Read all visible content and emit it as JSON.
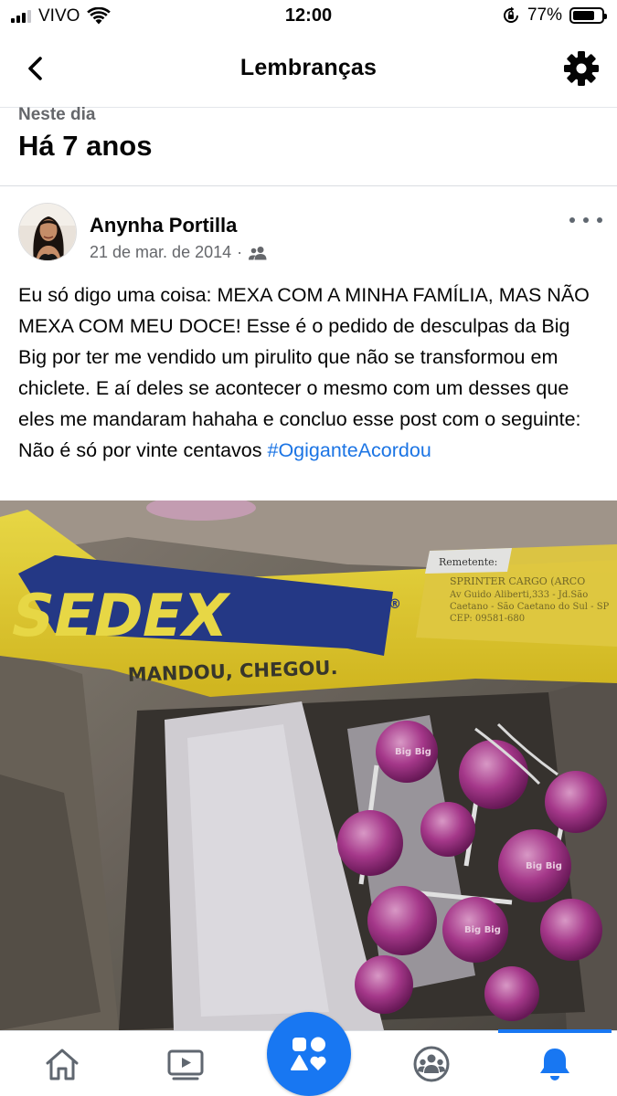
{
  "status_bar": {
    "carrier": "VIVO",
    "time": "12:00",
    "battery": "77%",
    "battery_level": 0.77,
    "icons": [
      "signal-icon",
      "wifi-icon",
      "orientation-lock-icon",
      "battery-icon"
    ]
  },
  "header": {
    "title": "Lembranças",
    "back_icon": "chevron-left-icon",
    "settings_icon": "gear-icon"
  },
  "memory": {
    "subtitle": "Neste dia",
    "title": "Há 7 anos"
  },
  "post": {
    "author": "Anynha Portilla",
    "date": "21 de mar. de 2014",
    "separator": "·",
    "privacy_icon": "friends-icon",
    "more_icon": "more-horizontal-icon",
    "text": "Eu só digo uma coisa: MEXA COM A MINHA FAMÍLIA, MAS NÃO MEXA COM MEU DOCE! Esse é o pedido de desculpas da Big Big por ter me vendido um pirulito que não se transformou em chiclete. E aí deles se acontecer o mesmo com um desses que eles me mandaram hahaha e concluo esse post com o seguinte: Não é só por vinte centavos",
    "hashtag": "#OgiganteAcordou",
    "photo": {
      "brand": "SEDEX",
      "registered": "®",
      "slogan": "MANDOU, CHEGOU.",
      "label_title": "Remetente:",
      "label_company": "SPRINTER CARGO (ARCO",
      "label_line1": "Av Guido Aliberti,333 - Jd.São",
      "label_line2": "Caetano - São Caetano do Sul - SP",
      "label_line3": "CEP: 09581-680",
      "lollipop_text": "Big Big"
    }
  },
  "tabbar": {
    "tabs": [
      {
        "name": "home",
        "icon": "home-icon"
      },
      {
        "name": "watch",
        "icon": "video-icon"
      },
      {
        "name": "menu",
        "icon": "shapes-icon"
      },
      {
        "name": "groups",
        "icon": "groups-icon"
      },
      {
        "name": "notifications",
        "icon": "bell-icon",
        "active": true
      }
    ],
    "accent": "#1877f2"
  }
}
